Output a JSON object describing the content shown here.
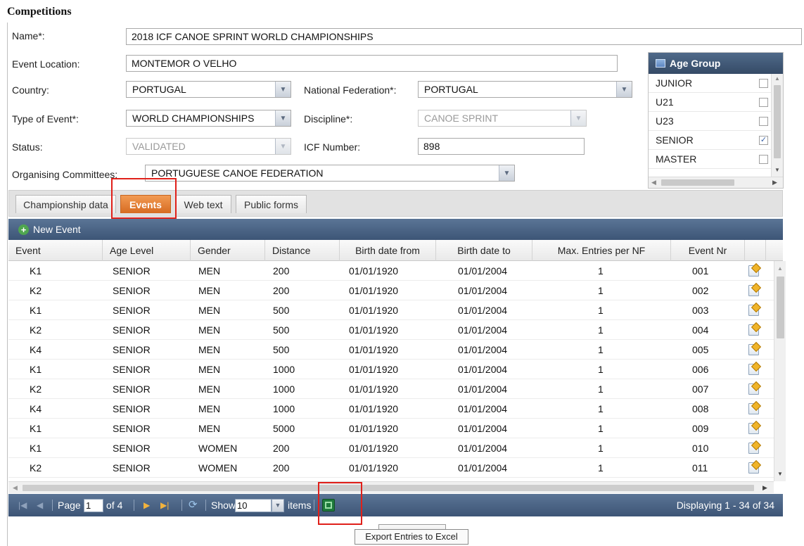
{
  "page": {
    "title": "Competitions"
  },
  "form": {
    "name_label": "Name*:",
    "name_value": "2018 ICF CANOE SPRINT WORLD CHAMPIONSHIPS",
    "location_label": "Event Location:",
    "location_value": "MONTEMOR O VELHO",
    "country_label": "Country:",
    "country_value": "PORTUGAL",
    "federation_label": "National Federation*:",
    "federation_value": "PORTUGAL",
    "type_label": "Type of Event*:",
    "type_value": "WORLD CHAMPIONSHIPS",
    "discipline_label": "Discipline*:",
    "discipline_value": "CANOE SPRINT",
    "status_label": "Status:",
    "status_value": "VALIDATED",
    "icf_label": "ICF Number:",
    "icf_value": "898",
    "committee_label": "Organising Committees:",
    "committee_value": "PORTUGUESE CANOE FEDERATION"
  },
  "age_group": {
    "title": "Age Group",
    "items": [
      {
        "label": "JUNIOR",
        "checked": false
      },
      {
        "label": "U21",
        "checked": false
      },
      {
        "label": "U23",
        "checked": false
      },
      {
        "label": "SENIOR",
        "checked": true
      },
      {
        "label": "MASTER",
        "checked": false
      }
    ]
  },
  "tabs": [
    {
      "label": "Championship data",
      "active": false
    },
    {
      "label": "Events",
      "active": true
    },
    {
      "label": "Web text",
      "active": false
    },
    {
      "label": "Public forms",
      "active": false
    }
  ],
  "toolbar": {
    "new_event_label": "New Event"
  },
  "grid": {
    "columns": [
      "Event",
      "Age Level",
      "Gender",
      "Distance",
      "Birth date from",
      "Birth date to",
      "Max. Entries per NF",
      "Event Nr"
    ],
    "rows": [
      [
        "K1",
        "SENIOR",
        "MEN",
        "200",
        "01/01/1920",
        "01/01/2004",
        "1",
        "001"
      ],
      [
        "K2",
        "SENIOR",
        "MEN",
        "200",
        "01/01/1920",
        "01/01/2004",
        "1",
        "002"
      ],
      [
        "K1",
        "SENIOR",
        "MEN",
        "500",
        "01/01/1920",
        "01/01/2004",
        "1",
        "003"
      ],
      [
        "K2",
        "SENIOR",
        "MEN",
        "500",
        "01/01/1920",
        "01/01/2004",
        "1",
        "004"
      ],
      [
        "K4",
        "SENIOR",
        "MEN",
        "500",
        "01/01/1920",
        "01/01/2004",
        "1",
        "005"
      ],
      [
        "K1",
        "SENIOR",
        "MEN",
        "1000",
        "01/01/1920",
        "01/01/2004",
        "1",
        "006"
      ],
      [
        "K2",
        "SENIOR",
        "MEN",
        "1000",
        "01/01/1920",
        "01/01/2004",
        "1",
        "007"
      ],
      [
        "K4",
        "SENIOR",
        "MEN",
        "1000",
        "01/01/1920",
        "01/01/2004",
        "1",
        "008"
      ],
      [
        "K1",
        "SENIOR",
        "MEN",
        "5000",
        "01/01/1920",
        "01/01/2004",
        "1",
        "009"
      ],
      [
        "K1",
        "SENIOR",
        "WOMEN",
        "200",
        "01/01/1920",
        "01/01/2004",
        "1",
        "010"
      ],
      [
        "K2",
        "SENIOR",
        "WOMEN",
        "200",
        "01/01/1920",
        "01/01/2004",
        "1",
        "011"
      ]
    ]
  },
  "pager": {
    "page_label": "Page",
    "page_value": "1",
    "of_label": "of 4",
    "show_label": "Show",
    "show_value": "10",
    "items_label": "items",
    "displaying": "Displaying 1 - 34 of 34"
  },
  "tooltip": {
    "export_label": "Export Entries to Excel"
  },
  "colors": {
    "header_blue": "#3d5576",
    "active_tab_orange": "#d66b21",
    "highlight_red": "#e0201a"
  }
}
